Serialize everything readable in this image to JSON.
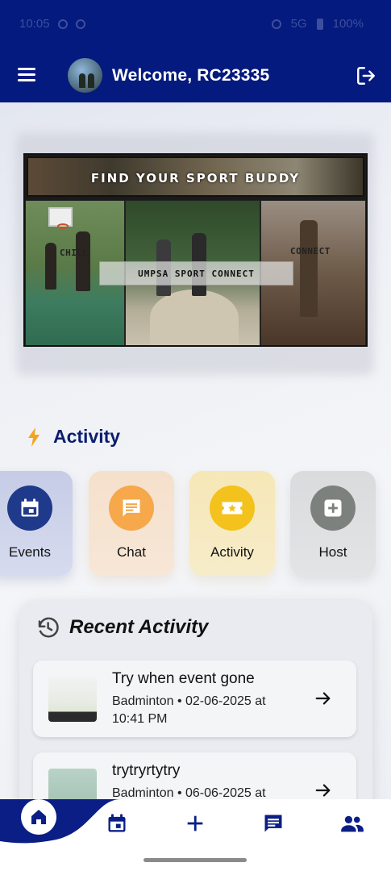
{
  "status_bar": {
    "time": "10:05",
    "network": "5G",
    "battery": "100%"
  },
  "app_bar": {
    "welcome_text": "Welcome, RC23335",
    "menu_icon": "hamburger-menu-icon",
    "logout_icon": "logout-icon"
  },
  "banner": {
    "top_text": "FIND YOUR SPORT BUDDY",
    "left_label": "CHILL",
    "center_label": "UMPSA SPORT CONNECT",
    "right_label": "CONNECT"
  },
  "activity_section": {
    "title": "Activity",
    "icon": "bolt-icon",
    "accent_color": "#f5a31a",
    "cards": [
      {
        "label": "Events",
        "icon": "calendar-icon",
        "color": "#1f3a8a"
      },
      {
        "label": "Chat",
        "icon": "chat-icon",
        "color": "#f6a84a"
      },
      {
        "label": "Activity",
        "icon": "ticket-star-icon",
        "color": "#f3c21c"
      },
      {
        "label": "Host",
        "icon": "add-box-icon",
        "color": "#7c817d"
      }
    ]
  },
  "recent_activity": {
    "title": "Recent Activity",
    "icon": "history-icon",
    "items": [
      {
        "title": "Try when event gone",
        "subtitle": "Badminton • 02-06-2025 at 10:41 PM"
      },
      {
        "title": "trytryrtytry",
        "subtitle": "Badminton • 06-06-2025 at"
      }
    ]
  },
  "bottom_nav": {
    "items": [
      "home-icon",
      "calendar-icon",
      "add-icon",
      "chat-icon",
      "people-icon"
    ],
    "active_color": "#0a1e86"
  }
}
